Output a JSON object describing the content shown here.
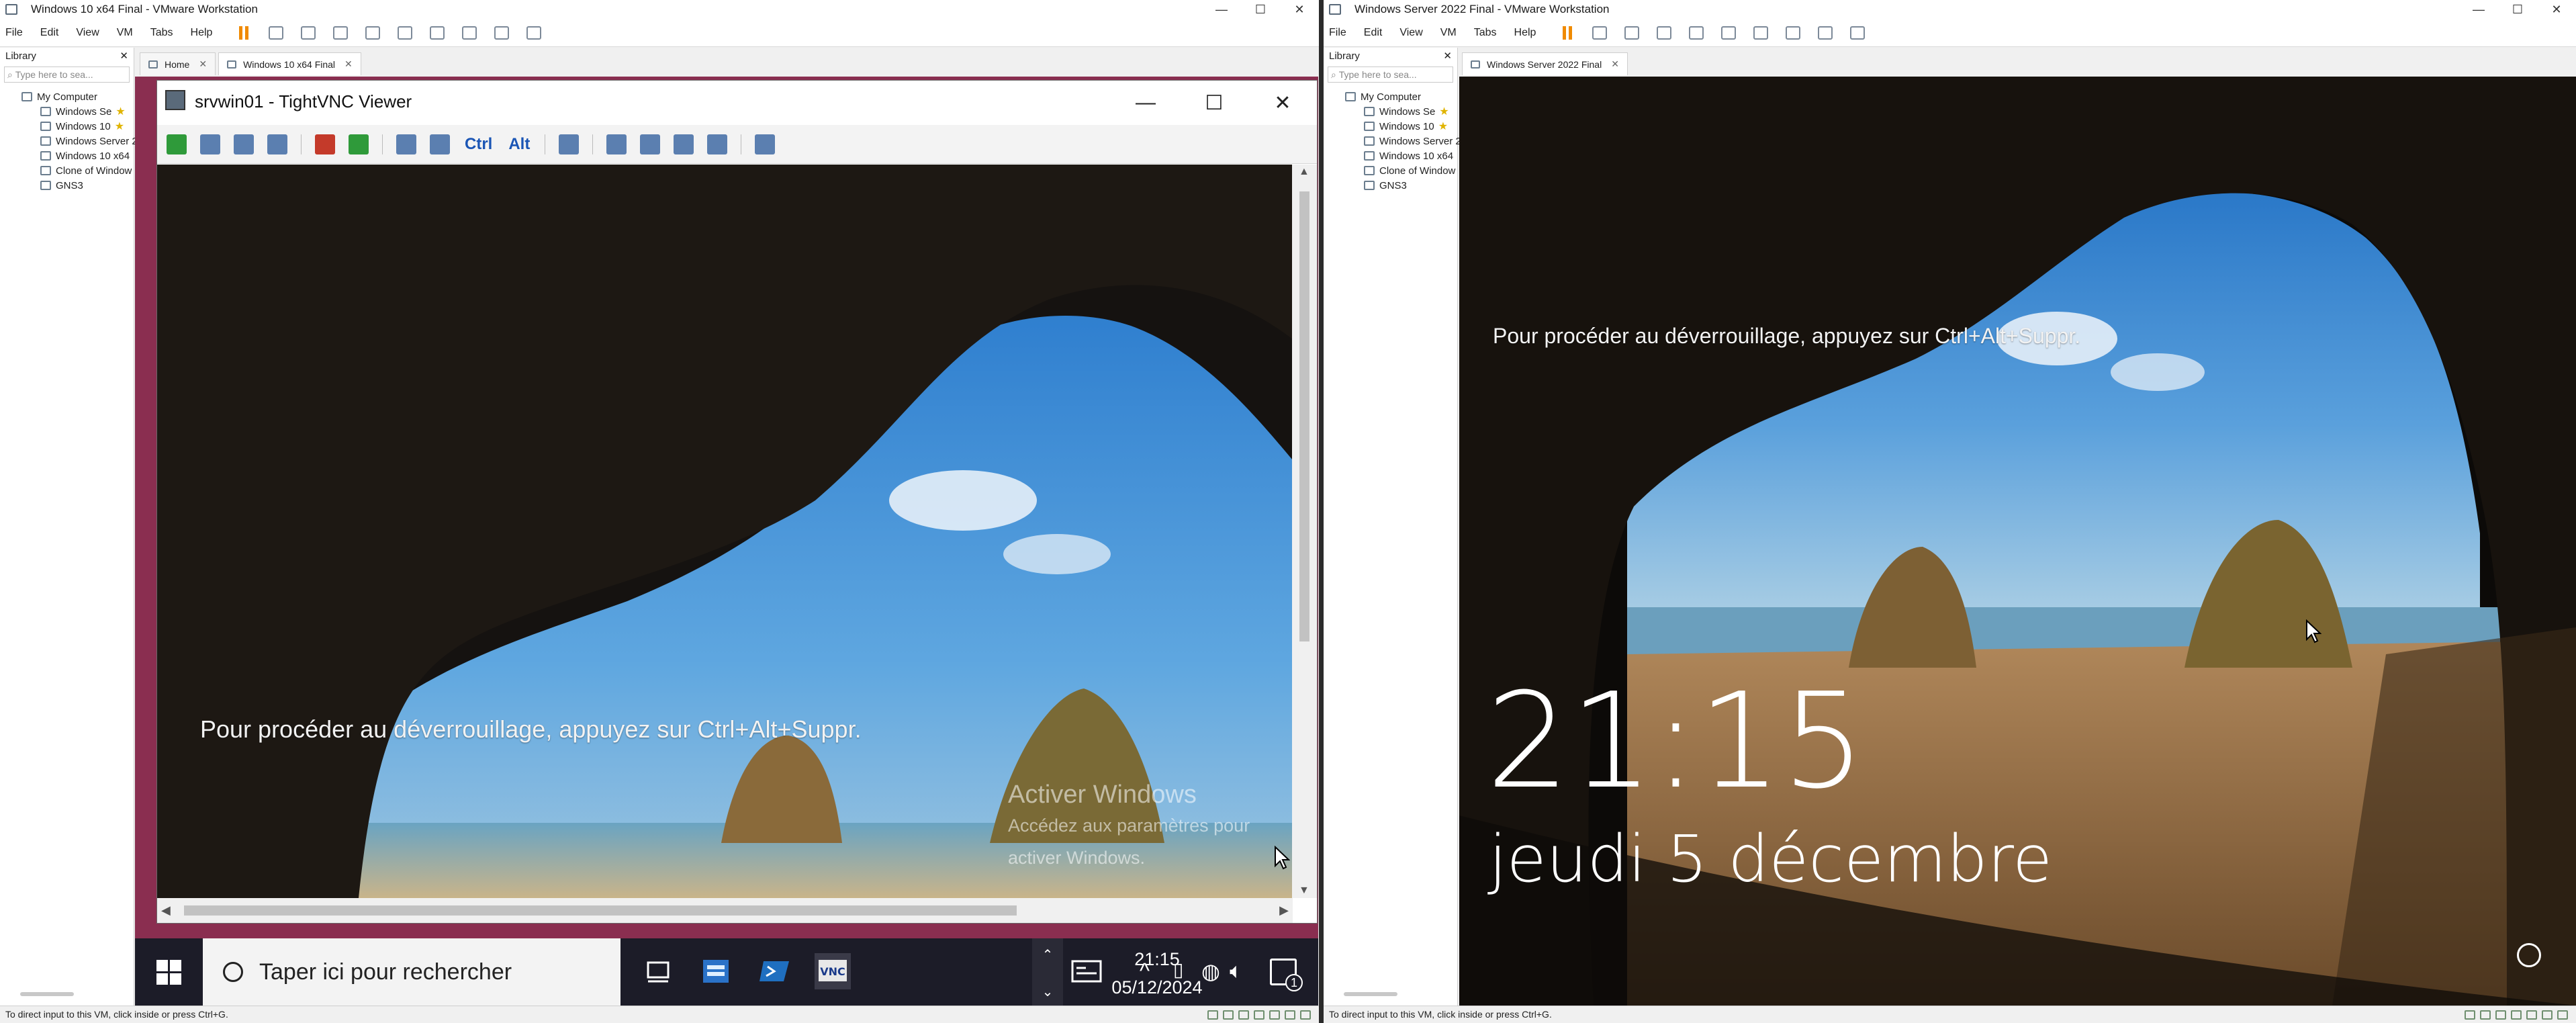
{
  "left_window": {
    "title": "Windows 10 x64 Final - VMware Workstation",
    "menu": [
      "File",
      "Edit",
      "View",
      "VM",
      "Tabs",
      "Help"
    ],
    "library": {
      "header": "Library",
      "search_placeholder": "Type here to sea...",
      "root": "My Computer",
      "items": [
        "Windows Se",
        "Windows 10",
        "Windows Server 2",
        "Windows 10 x64",
        "Clone of Window",
        "GNS3"
      ],
      "starred": [
        true,
        true,
        false,
        false,
        false,
        false
      ]
    },
    "tabs": [
      "Home",
      "Windows 10 x64 Final"
    ],
    "status": "To direct input to this VM, click inside or press Ctrl+G.",
    "vnc": {
      "title": "srvwin01 - TightVNC Viewer",
      "toolbar_text": [
        "Ctrl",
        "Alt"
      ],
      "unlock_message": "Pour procéder au déverrouillage, appuyez sur Ctrl+Alt+Suppr.",
      "activation_title": "Activer Windows",
      "activation_line1": "Accédez aux paramètres pour",
      "activation_line2": "activer Windows."
    },
    "taskbar": {
      "search_placeholder": "Taper ici pour rechercher",
      "time": "21:15",
      "date": "05/12/2024",
      "notification_count": "1",
      "accent": "#79b4e8"
    }
  },
  "right_window": {
    "title": "Windows Server 2022 Final - VMware Workstation",
    "menu": [
      "File",
      "Edit",
      "View",
      "VM",
      "Tabs",
      "Help"
    ],
    "library": {
      "header": "Library",
      "search_placeholder": "Type here to sea...",
      "root": "My Computer",
      "items": [
        "Windows Se",
        "Windows 10",
        "Windows Server 2",
        "Windows 10 x64",
        "Clone of Window",
        "GNS3"
      ],
      "starred": [
        true,
        true,
        false,
        false,
        false,
        false
      ]
    },
    "tabs": [
      "Windows Server 2022 Final"
    ],
    "status": "To direct input to this VM, click inside or press Ctrl+G.",
    "lockscreen": {
      "unlock_message": "Pour procéder au déverrouillage, appuyez sur Ctrl+Alt+Suppr.",
      "time": "21:15",
      "date": "jeudi 5 décembre"
    }
  },
  "colors": {
    "vmware_pause": "#f08a00",
    "vm_backdrop": "#8a2e50",
    "taskbar": "#1c1c28"
  }
}
